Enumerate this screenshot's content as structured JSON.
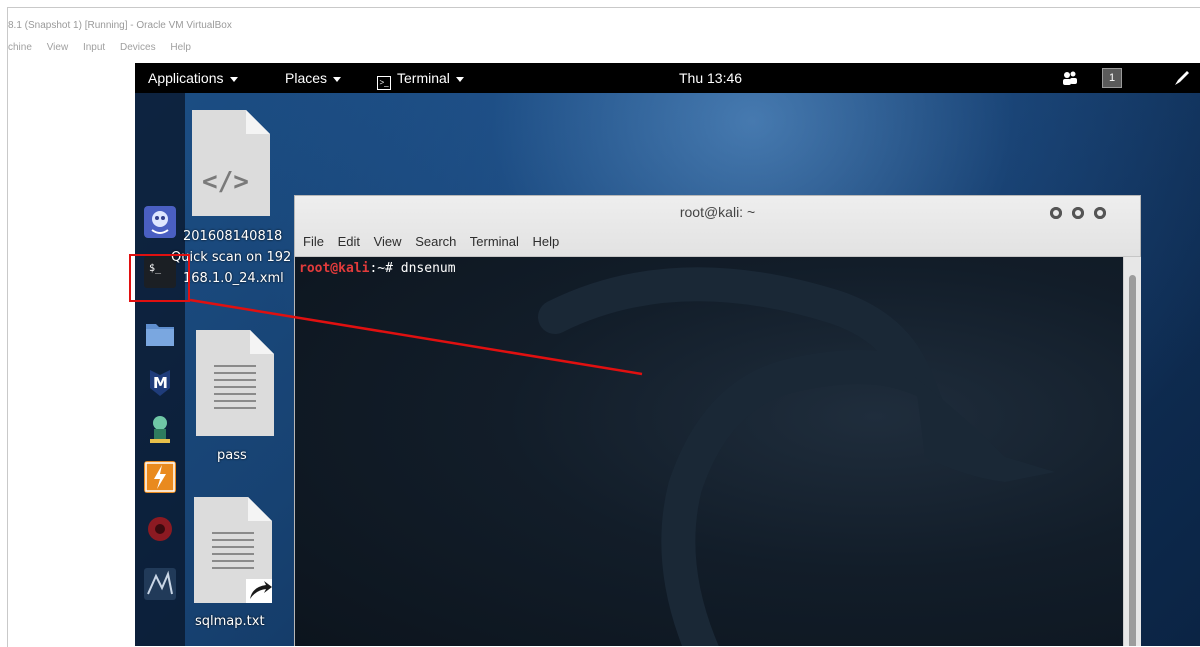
{
  "host": {
    "window_title": "8.1 (Snapshot 1) [Running] - Oracle VM VirtualBox",
    "menu": [
      "chine",
      "View",
      "Input",
      "Devices",
      "Help"
    ]
  },
  "topbar": {
    "applications": "Applications",
    "places": "Places",
    "terminal": "Terminal",
    "clock": "Thu 13:46",
    "workspace": "1"
  },
  "dock": {
    "items": [
      "zenmap-icon",
      "terminal-icon",
      "files-icon",
      "metasploit-icon",
      "armitage-icon",
      "burpsuite-icon",
      "faraday-icon",
      "maltego-icon"
    ]
  },
  "desktop": {
    "files": [
      {
        "label_line1": "201608140818",
        "label_line2": "Quick scan on 192",
        "label_line3": "168.1.0_24.xml"
      },
      {
        "label": "pass"
      },
      {
        "label": "sqlmap.txt"
      }
    ]
  },
  "terminal": {
    "title": "root@kali: ~",
    "menu": [
      "File",
      "Edit",
      "View",
      "Search",
      "Terminal",
      "Help"
    ],
    "prompt_user": "root@kali",
    "prompt_path": ":~# ",
    "command": "dnsenum"
  },
  "colors": {
    "annotation": "#e01010",
    "prompt_user": "#e23b3b",
    "topbar_bg": "#000000"
  }
}
